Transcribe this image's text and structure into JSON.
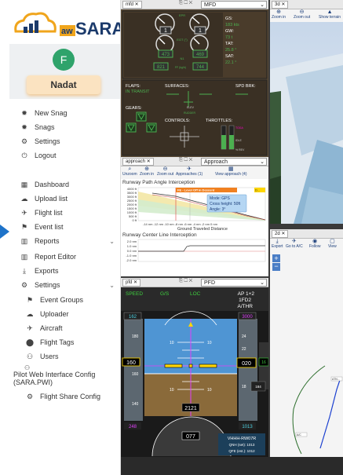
{
  "brand": {
    "name": "SARA",
    "prefix": "aw"
  },
  "user": {
    "initial": "F",
    "name": "Nadat"
  },
  "menu": {
    "new_snag": "New Snag",
    "snags": "Snags",
    "settings": "Settings",
    "logout": "Logout",
    "dashboard": "Dashboard",
    "upload_list": "Upload list",
    "flight_list": "Flight list",
    "event_list": "Event list",
    "reports": "Reports",
    "report_editor": "Report Editor",
    "exports": "Exports",
    "settings2": "Settings",
    "event_groups": "Event Groups",
    "uploader": "Uploader",
    "aircraft": "Aircraft",
    "flight_tags": "Flight Tags",
    "users": "Users",
    "pilot_web_1": "Pilot Web Interface Config",
    "pilot_web_2": "(SARA.PWI)",
    "flight_share": "Flight Share Config"
  },
  "mfd": {
    "tab": "mfd",
    "select": "MFD",
    "eng_left": "1",
    "eng_right": "1",
    "epr": "EPR",
    "egt": "EGT (°)",
    "egt_left": "473",
    "egt_right": "469",
    "n1": "N1",
    "ff_left": "821",
    "ff_right": "744",
    "ff_unit": "FF (kg/h)",
    "gs_label": "GS:",
    "gs_value": "183 kts",
    "gw_label": "GW:",
    "gw_value": "73 t",
    "tat_label": "TAT:",
    "tat_value": "25.8 °",
    "sat_label": "SAT:",
    "sat_value": "22.1 °",
    "flaps_label": "FLAPS:",
    "flaps_value": "IN TRANSIT",
    "surfaces": "SURFACES:",
    "spd_brk": "SPD BRK:",
    "gears": "GEARS:",
    "controls": "CONTROLS:",
    "throttles": "THROTTLES:",
    "elev": "ELEV",
    "rudder": "RUDDER",
    "toga": "TOGA",
    "idle": "IDLE",
    "rev": "% REV"
  },
  "approach": {
    "tab": "approach",
    "select": "Approach",
    "buttons": [
      "Unzoom",
      "Zoom in",
      "Zoom out",
      "Approaches (1)",
      "View approach (4)"
    ],
    "title1": "Runway Path Angle Interception",
    "banner": "FE - Level Off in Descent",
    "d_label": "D...",
    "tip_mode": "Mode: GPS",
    "tip_cross": "Cross height: 50ft",
    "tip_angle": "Angle: 3°",
    "yticks": [
      "4000 ft",
      "3500 ft",
      "3000 ft",
      "2500 ft",
      "2000 ft",
      "1500 ft",
      "1000 ft",
      "500 ft",
      "0 ft"
    ],
    "xticks": "-14 nm -12 nm -10 nm -8 nm -6 nm -4 nm -2 nm 0 nm",
    "xlabel": "Ground Traveled Distance",
    "title2": "Runway Center Line Interception",
    "yticks2": [
      "2.0 nm",
      "1.0 nm",
      "0.0 nm",
      "-1.0 nm",
      "-2.0 nm"
    ]
  },
  "pfd": {
    "tab": "pfd",
    "select": "PFD",
    "speed": "SPEED",
    "gs": "G/S",
    "loc": "LOC",
    "ap": "AP 1+2",
    "fd": "1FD2",
    "athr": "A/THR",
    "spd_top": "162",
    "spd_cur": "160",
    "spd_vals": [
      "180",
      "160",
      "140"
    ],
    "spd_bottom": "248",
    "pitch_vals": [
      "10",
      "10",
      "10",
      "10"
    ],
    "alt_top": "3000",
    "alt_cur": "020",
    "alt_vals": [
      "24",
      "22",
      "18"
    ],
    "alt_bottom": "1013",
    "alt_box": "020",
    "alt_right": "16",
    "vs_box": "184",
    "radio": "2121",
    "hdg": "077",
    "rwy": "VHHH-RW07R",
    "qnh": "QNH (set): 1013",
    "qfe": "QFE (est.): 1012"
  },
  "view3d": {
    "tab": "3d",
    "buttons": [
      "Zoom in",
      "Zoom out",
      "Show terrain"
    ]
  },
  "view2d": {
    "tab": "2d",
    "buttons": [
      "Export",
      "Go to A/C",
      "Follow",
      "View"
    ]
  },
  "map": {
    "label1": "ATN...",
    "label2": "A/C"
  },
  "colors": {
    "accent": "#1a4a8a",
    "sidebar_bg": "#ffffff",
    "pill": "#fbe3c1"
  }
}
